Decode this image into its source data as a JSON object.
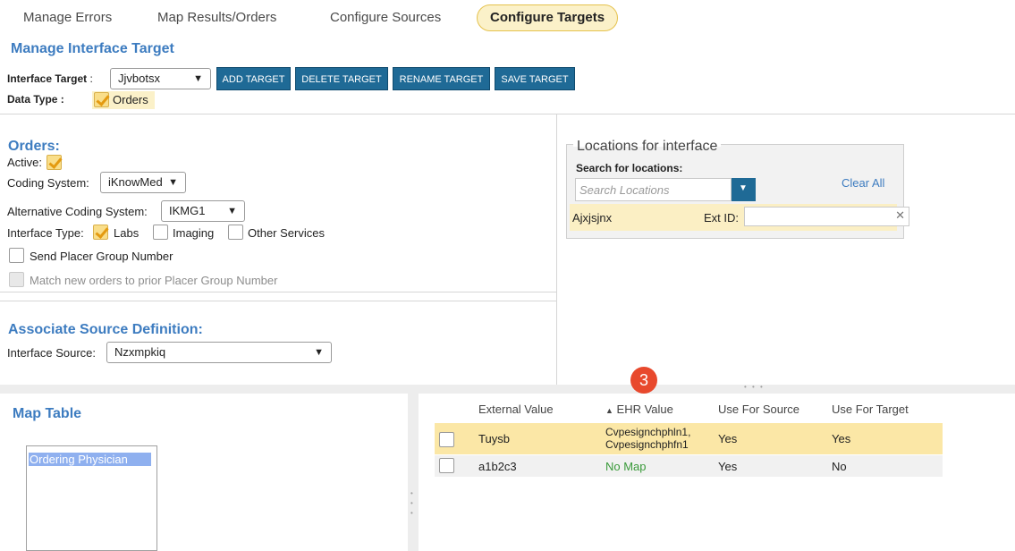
{
  "tabs": [
    {
      "label": "Manage Errors"
    },
    {
      "label": "Map Results/Orders"
    },
    {
      "label": "Configure Sources"
    },
    {
      "label": "Configure Targets"
    }
  ],
  "manage": {
    "title": "Manage Interface Target",
    "target_label": "Interface Target",
    "target_colon": ":",
    "target_value": "Jjvbotsx",
    "buttons": [
      "ADD TARGET",
      "DELETE TARGET",
      "RENAME TARGET",
      "SAVE TARGET"
    ],
    "data_type_label": "Data Type :",
    "data_type_value": "Orders"
  },
  "orders": {
    "title": "Orders:",
    "active_label": "Active:",
    "coding_label": "Coding System:",
    "coding_value": "iKnowMed",
    "alt_coding_label": "Alternative Coding System:",
    "alt_coding_value": "IKMG1",
    "interface_type_label": "Interface Type:",
    "type_labs": "Labs",
    "type_imaging": "Imaging",
    "type_other": "Other Services",
    "send_placer": "Send Placer Group Number",
    "match_orders": "Match new orders to prior Placer Group Number"
  },
  "associate": {
    "title": "Associate Source Definition:",
    "source_label": "Interface Source:",
    "source_value": "Nzxmpkiq"
  },
  "locations": {
    "title": "Locations for interface",
    "search_label": "Search for locations:",
    "search_placeholder": "Search Locations",
    "clear_all": "Clear All",
    "item_name": "Ajxjsjnx",
    "ext_id_label": "Ext ID:",
    "ext_id_value": ""
  },
  "map_table": {
    "title": "Map Table",
    "list_items": [
      "Ordering Physician"
    ],
    "badge": "3",
    "splitter_dots": "• • •",
    "columns": {
      "external": "External Value",
      "ehr": "EHR Value",
      "use_source": "Use For Source",
      "use_target": "Use For Target"
    },
    "rows": [
      {
        "external": "Tuysb",
        "ehr_line1": "Cvpesignchphln1,",
        "ehr_line2": "Cvpesignchphfn1",
        "use_source": "Yes",
        "use_target": "Yes"
      },
      {
        "external": "a1b2c3",
        "ehr": "No Map",
        "use_source": "Yes",
        "use_target": "No"
      }
    ]
  },
  "colors": {
    "accent_blue": "#3d7cc0",
    "button_blue": "#1f6a96",
    "highlight_row": "#fbe7a6",
    "badge_red": "#e8492d",
    "no_map_green": "#3a9a3a"
  }
}
